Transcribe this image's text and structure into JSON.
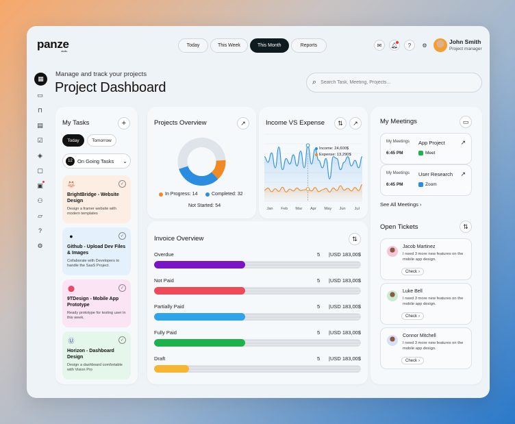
{
  "header": {
    "logo": "panze",
    "logo_sub": "studio.",
    "periods": [
      "Today",
      "This Week",
      "This Month",
      "Reports"
    ],
    "active_period": "This Month",
    "user_name": "John Smith",
    "user_role": "Project manager"
  },
  "page": {
    "subtitle": "Manage and track your projects",
    "title": "Project Dashboard",
    "search_placeholder": "Search Task, Meeting, Projects..."
  },
  "tasks": {
    "title": "My Tasks",
    "tab_today": "Today",
    "tab_tomorrow": "Tomorrow",
    "ongoing_count": "12",
    "ongoing_label": "On Going Tasks",
    "items": [
      {
        "name": "BrightBridge - Website Design",
        "desc": "Design a framer website with modern templates",
        "bg": "#fdeee4",
        "icon": "fox-logo-icon"
      },
      {
        "name": "Github - Upload Dev Files & Images",
        "desc": "Collaborate with Developers to handle the SaaS Project.",
        "bg": "#e4f0fb",
        "icon": "github-icon"
      },
      {
        "name": "9TDesign - Mobile App Prototype",
        "desc": "Ready prototype for testing user in this week.",
        "bg": "#fbe4f4",
        "icon": "design-logo-icon"
      },
      {
        "name": "Horizon - Dashboard Design",
        "desc": "Design a dashboard comfortable with Vision Pro",
        "bg": "#e4f7ea",
        "icon": "horizon-logo-icon"
      }
    ]
  },
  "projects": {
    "title": "Projects Overview",
    "in_progress_label": "In Progress: 14",
    "completed_label": "Completed: 32",
    "not_started_label": "Not Started: 54",
    "in_progress": 14,
    "completed": 32,
    "not_started": 54,
    "colors": {
      "in_progress": "#f08a24",
      "completed": "#2a8de0",
      "not_started": "#dfe3ea"
    }
  },
  "income": {
    "title": "Income VS Expense",
    "tooltip_income": "Income: 24,600$",
    "tooltip_expense": "Expense: 13,290$"
  },
  "chart_data": {
    "type": "line",
    "title": "Income VS Expense",
    "categories": [
      "Jan",
      "Feb",
      "Mar",
      "Apr",
      "May",
      "Jun",
      "Jul"
    ],
    "series": [
      {
        "name": "Income",
        "color": "#2a8de0",
        "values": [
          22000,
          20500,
          23000,
          19000,
          24600,
          18500,
          21500,
          20000,
          22500,
          19500,
          23500,
          19000,
          25000,
          20000,
          24000,
          21000,
          19000,
          21500,
          16000,
          22000,
          21500,
          18500,
          20500,
          22000,
          19500,
          21000,
          19000,
          22000
        ]
      },
      {
        "name": "Expense",
        "color": "#f08a24",
        "values": [
          13000,
          13600,
          12600,
          13400,
          12700,
          13800,
          12500,
          13300,
          12800,
          13600,
          12900,
          13100,
          13290,
          12800,
          13700,
          12600,
          13100,
          13500,
          12500,
          13600,
          12900,
          14200,
          13000,
          13500,
          12800,
          13700,
          12900,
          14500
        ]
      }
    ],
    "ylim": [
      10000,
      28000
    ],
    "grid": true
  },
  "invoice": {
    "title": "Invoice Overview",
    "rows": [
      {
        "label": "Overdue",
        "count": "5",
        "amount": "USD 183,00$",
        "fill": 0.44,
        "color": "#7b14c6"
      },
      {
        "label": "Not Paid",
        "count": "5",
        "amount": "USD 183,00$",
        "fill": 0.44,
        "color": "#ef4a5a"
      },
      {
        "label": "Partially Paid",
        "count": "5",
        "amount": "USD 183,00$",
        "fill": 0.44,
        "color": "#2ea4ea"
      },
      {
        "label": "Fully Paid",
        "count": "5",
        "amount": "USD 183,00$",
        "fill": 0.44,
        "color": "#1db34a"
      },
      {
        "label": "Draft",
        "count": "5",
        "amount": "USD 183,00$",
        "fill": 0.17,
        "color": "#f7b533"
      }
    ],
    "separator": "|"
  },
  "meetings": {
    "title": "My Meetings",
    "items": [
      {
        "label": "My Meetings",
        "time": "6:45 PM",
        "name": "App Project",
        "platform": "Meet",
        "pcolor": "#1db34a"
      },
      {
        "label": "My Meetings",
        "time": "6:45 PM",
        "name": "User Research",
        "platform": "Zoom",
        "pcolor": "#2a8de0"
      }
    ],
    "see_all": "See All Meetings"
  },
  "tickets": {
    "title": "Open Tickets",
    "check": "Check",
    "items": [
      {
        "name": "Jacob Martinez",
        "msg": "I need 3 more new features on the mobile app design.",
        "avatar": "#f4c6d8"
      },
      {
        "name": "Luke Bell",
        "msg": "I need 3 more new features on the mobile app design.",
        "avatar": "#c9ecd4"
      },
      {
        "name": "Connor Mitchell",
        "msg": "I need 3 more new features on the mobile app design.",
        "avatar": "#d9dff7"
      }
    ]
  }
}
